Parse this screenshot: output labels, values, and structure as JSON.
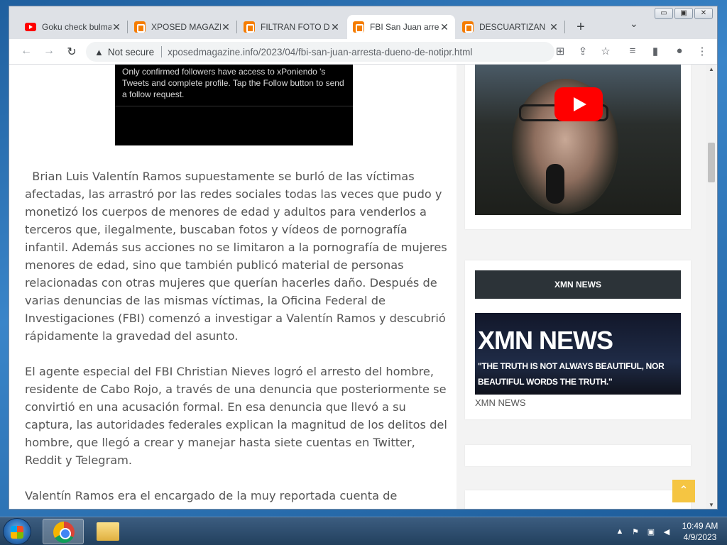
{
  "browser": {
    "tabs": [
      {
        "title": "Goku check bulma",
        "favicon": "youtube-icon",
        "active": false
      },
      {
        "title": "XPOSED MAGAZINE",
        "favicon": "blogger-icon",
        "active": false
      },
      {
        "title": "FILTRAN FOTO DE",
        "favicon": "blogger-icon",
        "active": false
      },
      {
        "title": "FBI San Juan arresta",
        "favicon": "blogger-icon",
        "active": true
      },
      {
        "title": "DESCUARTIZAN",
        "favicon": "blogger-icon",
        "active": false
      }
    ],
    "new_tab_label": "+",
    "security_label": "Not secure",
    "url": "xposedmagazine.info/2023/04/fbi-san-juan-arresta-dueno-de-notipr.html"
  },
  "article": {
    "tweet_text": "Only confirmed followers have access to xPoniendo 's Tweets and complete profile. Tap the Follow button to send a follow request.",
    "paragraphs": [
      "  Brian Luis Valentín Ramos supuestamente se burló de las víctimas afectadas, las arrastró por las redes sociales todas las veces que pudo y monetizó los cuerpos de menores de edad y adultos para venderlos a terceros que, ilegalmente, buscaban fotos y vídeos de pornografía infantil. Además sus acciones no se limitaron a la pornografía de mujeres menores de edad, sino que también publicó material de personas relacionadas con otras mujeres que querían hacerles daño. Después de varias denuncias de las mismas víctimas, la Oficina Federal de Investigaciones (FBI) comenzó a investigar a Valentín Ramos y descubrió rápidamente la gravedad del asunto.",
      "El agente especial del FBI Christian Nieves logró el arresto del hombre, residente de Cabo Rojo, a través de una denuncia que posteriormente se convirtió en una acusación formal. En esa denuncia que llevó a su captura, las autoridades federales explican la magnitud de los delitos del hombre, que llegó a crear y manejar hasta siete cuentas en Twitter, Reddit y Telegram.",
      "Valentín Ramos era el encargado de la muy reportada cuenta de"
    ]
  },
  "sidebar": {
    "widget_title": "XMN NEWS",
    "banner_title": "XMN NEWS",
    "banner_tagline": "\"THE TRUTH IS NOT ALWAYS BEAUTIFUL, NOR BEAUTIFUL WORDS THE TRUTH.\"",
    "banner_caption": "XMN NEWS"
  },
  "taskbar": {
    "time": "10:49 AM",
    "date": "4/9/2023"
  },
  "colors": {
    "accent_blogger": "#f57d00",
    "youtube_red": "#ff0000",
    "widget_header": "#2c3338",
    "back_to_top": "#f5c542"
  }
}
